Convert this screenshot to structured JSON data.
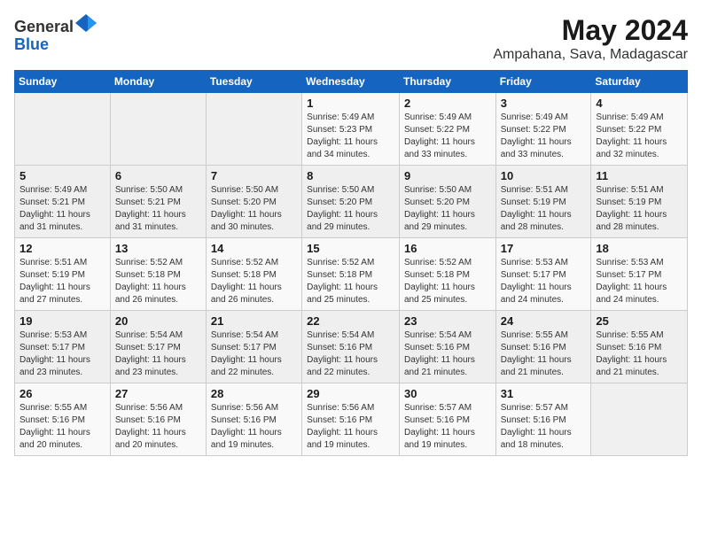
{
  "logo": {
    "general": "General",
    "blue": "Blue"
  },
  "header": {
    "month": "May 2024",
    "location": "Ampahana, Sava, Madagascar"
  },
  "weekdays": [
    "Sunday",
    "Monday",
    "Tuesday",
    "Wednesday",
    "Thursday",
    "Friday",
    "Saturday"
  ],
  "weeks": [
    [
      {
        "day": "",
        "sunrise": "",
        "sunset": "",
        "daylight": ""
      },
      {
        "day": "",
        "sunrise": "",
        "sunset": "",
        "daylight": ""
      },
      {
        "day": "",
        "sunrise": "",
        "sunset": "",
        "daylight": ""
      },
      {
        "day": "1",
        "sunrise": "Sunrise: 5:49 AM",
        "sunset": "Sunset: 5:23 PM",
        "daylight": "Daylight: 11 hours and 34 minutes."
      },
      {
        "day": "2",
        "sunrise": "Sunrise: 5:49 AM",
        "sunset": "Sunset: 5:22 PM",
        "daylight": "Daylight: 11 hours and 33 minutes."
      },
      {
        "day": "3",
        "sunrise": "Sunrise: 5:49 AM",
        "sunset": "Sunset: 5:22 PM",
        "daylight": "Daylight: 11 hours and 33 minutes."
      },
      {
        "day": "4",
        "sunrise": "Sunrise: 5:49 AM",
        "sunset": "Sunset: 5:22 PM",
        "daylight": "Daylight: 11 hours and 32 minutes."
      }
    ],
    [
      {
        "day": "5",
        "sunrise": "Sunrise: 5:49 AM",
        "sunset": "Sunset: 5:21 PM",
        "daylight": "Daylight: 11 hours and 31 minutes."
      },
      {
        "day": "6",
        "sunrise": "Sunrise: 5:50 AM",
        "sunset": "Sunset: 5:21 PM",
        "daylight": "Daylight: 11 hours and 31 minutes."
      },
      {
        "day": "7",
        "sunrise": "Sunrise: 5:50 AM",
        "sunset": "Sunset: 5:20 PM",
        "daylight": "Daylight: 11 hours and 30 minutes."
      },
      {
        "day": "8",
        "sunrise": "Sunrise: 5:50 AM",
        "sunset": "Sunset: 5:20 PM",
        "daylight": "Daylight: 11 hours and 29 minutes."
      },
      {
        "day": "9",
        "sunrise": "Sunrise: 5:50 AM",
        "sunset": "Sunset: 5:20 PM",
        "daylight": "Daylight: 11 hours and 29 minutes."
      },
      {
        "day": "10",
        "sunrise": "Sunrise: 5:51 AM",
        "sunset": "Sunset: 5:19 PM",
        "daylight": "Daylight: 11 hours and 28 minutes."
      },
      {
        "day": "11",
        "sunrise": "Sunrise: 5:51 AM",
        "sunset": "Sunset: 5:19 PM",
        "daylight": "Daylight: 11 hours and 28 minutes."
      }
    ],
    [
      {
        "day": "12",
        "sunrise": "Sunrise: 5:51 AM",
        "sunset": "Sunset: 5:19 PM",
        "daylight": "Daylight: 11 hours and 27 minutes."
      },
      {
        "day": "13",
        "sunrise": "Sunrise: 5:52 AM",
        "sunset": "Sunset: 5:18 PM",
        "daylight": "Daylight: 11 hours and 26 minutes."
      },
      {
        "day": "14",
        "sunrise": "Sunrise: 5:52 AM",
        "sunset": "Sunset: 5:18 PM",
        "daylight": "Daylight: 11 hours and 26 minutes."
      },
      {
        "day": "15",
        "sunrise": "Sunrise: 5:52 AM",
        "sunset": "Sunset: 5:18 PM",
        "daylight": "Daylight: 11 hours and 25 minutes."
      },
      {
        "day": "16",
        "sunrise": "Sunrise: 5:52 AM",
        "sunset": "Sunset: 5:18 PM",
        "daylight": "Daylight: 11 hours and 25 minutes."
      },
      {
        "day": "17",
        "sunrise": "Sunrise: 5:53 AM",
        "sunset": "Sunset: 5:17 PM",
        "daylight": "Daylight: 11 hours and 24 minutes."
      },
      {
        "day": "18",
        "sunrise": "Sunrise: 5:53 AM",
        "sunset": "Sunset: 5:17 PM",
        "daylight": "Daylight: 11 hours and 24 minutes."
      }
    ],
    [
      {
        "day": "19",
        "sunrise": "Sunrise: 5:53 AM",
        "sunset": "Sunset: 5:17 PM",
        "daylight": "Daylight: 11 hours and 23 minutes."
      },
      {
        "day": "20",
        "sunrise": "Sunrise: 5:54 AM",
        "sunset": "Sunset: 5:17 PM",
        "daylight": "Daylight: 11 hours and 23 minutes."
      },
      {
        "day": "21",
        "sunrise": "Sunrise: 5:54 AM",
        "sunset": "Sunset: 5:17 PM",
        "daylight": "Daylight: 11 hours and 22 minutes."
      },
      {
        "day": "22",
        "sunrise": "Sunrise: 5:54 AM",
        "sunset": "Sunset: 5:16 PM",
        "daylight": "Daylight: 11 hours and 22 minutes."
      },
      {
        "day": "23",
        "sunrise": "Sunrise: 5:54 AM",
        "sunset": "Sunset: 5:16 PM",
        "daylight": "Daylight: 11 hours and 21 minutes."
      },
      {
        "day": "24",
        "sunrise": "Sunrise: 5:55 AM",
        "sunset": "Sunset: 5:16 PM",
        "daylight": "Daylight: 11 hours and 21 minutes."
      },
      {
        "day": "25",
        "sunrise": "Sunrise: 5:55 AM",
        "sunset": "Sunset: 5:16 PM",
        "daylight": "Daylight: 11 hours and 21 minutes."
      }
    ],
    [
      {
        "day": "26",
        "sunrise": "Sunrise: 5:55 AM",
        "sunset": "Sunset: 5:16 PM",
        "daylight": "Daylight: 11 hours and 20 minutes."
      },
      {
        "day": "27",
        "sunrise": "Sunrise: 5:56 AM",
        "sunset": "Sunset: 5:16 PM",
        "daylight": "Daylight: 11 hours and 20 minutes."
      },
      {
        "day": "28",
        "sunrise": "Sunrise: 5:56 AM",
        "sunset": "Sunset: 5:16 PM",
        "daylight": "Daylight: 11 hours and 19 minutes."
      },
      {
        "day": "29",
        "sunrise": "Sunrise: 5:56 AM",
        "sunset": "Sunset: 5:16 PM",
        "daylight": "Daylight: 11 hours and 19 minutes."
      },
      {
        "day": "30",
        "sunrise": "Sunrise: 5:57 AM",
        "sunset": "Sunset: 5:16 PM",
        "daylight": "Daylight: 11 hours and 19 minutes."
      },
      {
        "day": "31",
        "sunrise": "Sunrise: 5:57 AM",
        "sunset": "Sunset: 5:16 PM",
        "daylight": "Daylight: 11 hours and 18 minutes."
      },
      {
        "day": "",
        "sunrise": "",
        "sunset": "",
        "daylight": ""
      }
    ]
  ]
}
